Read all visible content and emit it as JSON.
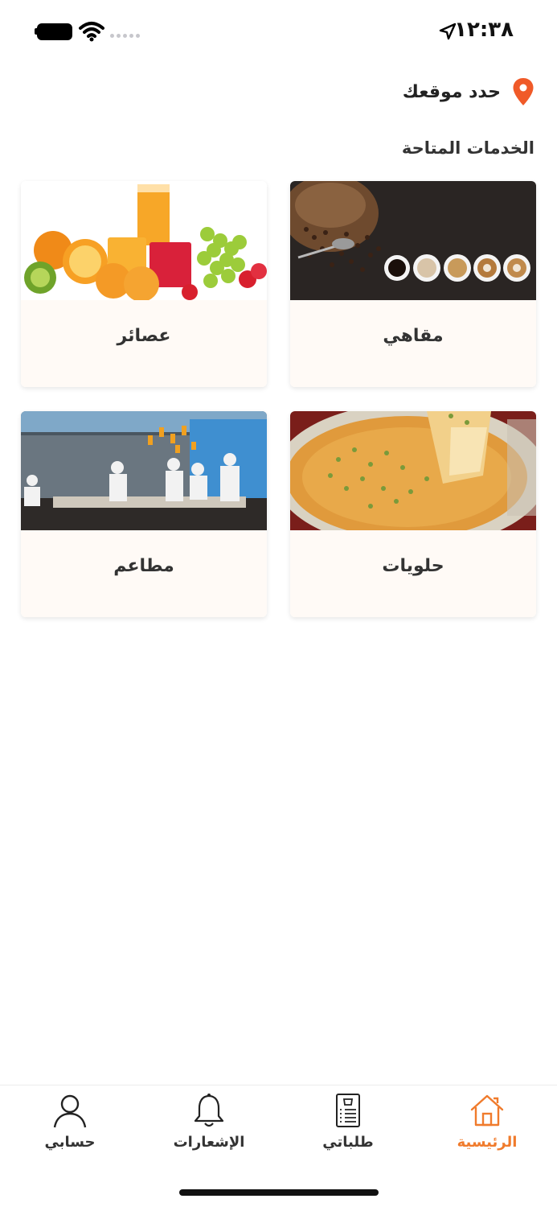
{
  "status_bar": {
    "time": "١٢:٣٨"
  },
  "location": {
    "label": "حدد موقعك",
    "pin_color": "#f05a28"
  },
  "services": {
    "title": "الخدمات المتاحة",
    "items": [
      {
        "label": "مقاهي",
        "image": "coffee-image"
      },
      {
        "label": "عصائر",
        "image": "juice-image"
      },
      {
        "label": "حلويات",
        "image": "kunafa-image"
      },
      {
        "label": "مطاعم",
        "image": "restaurant-kitchen-image"
      }
    ]
  },
  "bottom_nav": {
    "accent_color": "#f07b2c",
    "items": [
      {
        "label": "الرئيسية",
        "icon": "home-icon",
        "active": true
      },
      {
        "label": "طلباتي",
        "icon": "orders-icon",
        "active": false
      },
      {
        "label": "الإشعارات",
        "icon": "bell-icon",
        "active": false
      },
      {
        "label": "حسابي",
        "icon": "user-icon",
        "active": false
      }
    ]
  }
}
